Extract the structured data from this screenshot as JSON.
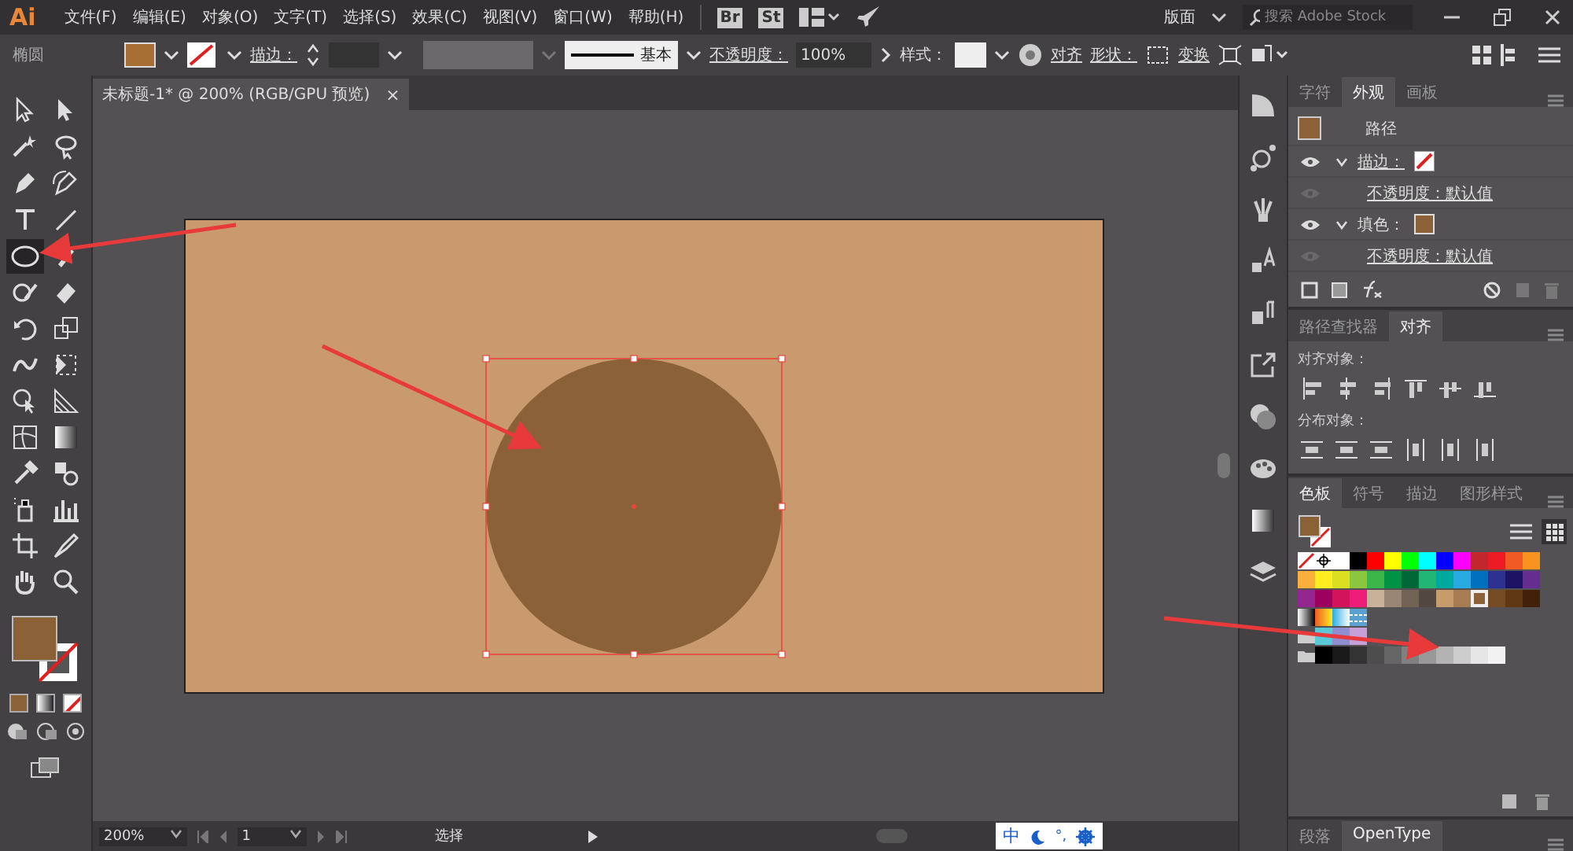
{
  "app": {
    "logo": "Ai",
    "bridge": "Br",
    "stock": "St",
    "workspace": "版面",
    "search_placeholder": "搜索 Adobe Stock"
  },
  "menu": [
    "文件(F)",
    "编辑(E)",
    "对象(O)",
    "文字(T)",
    "选择(S)",
    "效果(C)",
    "视图(V)",
    "窗口(W)",
    "帮助(H)"
  ],
  "control_bar": {
    "selection": "椭圆",
    "stroke_label": "描边：",
    "stroke_profile": "基本",
    "opacity_label": "不透明度：",
    "opacity": "100%",
    "style_label": "样式：",
    "align": "对齐",
    "shape_label": "形状：",
    "transform": "变换"
  },
  "document_tab": {
    "title": "未标题-1* @ 200% (RGB/GPU 预览)",
    "close": "×"
  },
  "tools": [
    {
      "selected": false
    },
    {
      "selected": false
    },
    {
      "selected": false
    },
    {
      "selected": false
    },
    {
      "selected": false
    },
    {
      "selected": false
    },
    {
      "selected": false
    },
    {
      "selected": false
    },
    {
      "selected": true
    },
    {
      "selected": false
    },
    {
      "selected": false
    },
    {
      "selected": false
    },
    {
      "selected": false
    },
    {
      "selected": false
    },
    {
      "selected": false
    },
    {
      "selected": false
    },
    {
      "selected": false
    },
    {
      "selected": false
    },
    {
      "selected": false
    },
    {
      "selected": false
    },
    {
      "selected": false
    },
    {
      "selected": false
    },
    {
      "selected": false
    },
    {
      "selected": false
    },
    {
      "selected": false
    },
    {
      "selected": false
    },
    {
      "selected": false
    },
    {
      "selected": false
    }
  ],
  "appearance_panel": {
    "tabs": [
      {
        "label": "字符",
        "selected": false
      },
      {
        "label": "外观",
        "selected": true
      },
      {
        "label": "画板",
        "selected": false
      }
    ],
    "title": "路径",
    "rows": [
      {
        "kind": "stroke",
        "label": "描边：",
        "expanded": true
      },
      {
        "kind": "sub",
        "label": "不透明度：默认值"
      },
      {
        "kind": "fill",
        "label": "填色：",
        "expanded": true
      },
      {
        "kind": "sub",
        "label": "不透明度：默认值"
      }
    ]
  },
  "align_panel": {
    "tabs": [
      {
        "label": "路径查找器",
        "selected": false
      },
      {
        "label": "对齐",
        "selected": true
      }
    ],
    "align_label": "对齐对象：",
    "distribute_label": "分布对象："
  },
  "swatches_panel": {
    "tabs": [
      {
        "label": "色板",
        "selected": true
      },
      {
        "label": "符号",
        "selected": false
      },
      {
        "label": "描边",
        "selected": false
      },
      {
        "label": "图形样式",
        "selected": false
      }
    ],
    "rows": [
      [
        {
          "kind": "none",
          "selected": false
        },
        {
          "kind": "registration",
          "selected": false
        },
        {
          "color": "#ffffff",
          "selected": false
        },
        {
          "color": "#000000",
          "selected": false
        },
        {
          "color": "#ff0000",
          "selected": false
        },
        {
          "color": "#ffff00",
          "selected": false
        },
        {
          "color": "#00ff00",
          "selected": false
        },
        {
          "color": "#00ffff",
          "selected": false
        },
        {
          "color": "#0000ff",
          "selected": false
        },
        {
          "color": "#ff00ff",
          "selected": false
        },
        {
          "color": "#c1272d",
          "selected": false
        },
        {
          "color": "#ed1c24",
          "selected": false
        },
        {
          "color": "#f15a24",
          "selected": false
        },
        {
          "color": "#f7931e",
          "selected": false
        }
      ],
      [
        {
          "color": "#fbb03b",
          "selected": false
        },
        {
          "color": "#fcee21",
          "selected": false
        },
        {
          "color": "#d9e021",
          "selected": false
        },
        {
          "color": "#8cc63f",
          "selected": false
        },
        {
          "color": "#39b54a",
          "selected": false
        },
        {
          "color": "#009245",
          "selected": false
        },
        {
          "color": "#006837",
          "selected": false
        },
        {
          "color": "#22b573",
          "selected": false
        },
        {
          "color": "#00a99d",
          "selected": false
        },
        {
          "color": "#29abe2",
          "selected": false
        },
        {
          "color": "#0071bc",
          "selected": false
        },
        {
          "color": "#2e3192",
          "selected": false
        },
        {
          "color": "#1b1464",
          "selected": false
        },
        {
          "color": "#662d91",
          "selected": false
        }
      ],
      [
        {
          "color": "#93278f",
          "selected": false
        },
        {
          "color": "#9e005d",
          "selected": false
        },
        {
          "color": "#d4145a",
          "selected": false
        },
        {
          "color": "#ed1e79",
          "selected": false
        },
        {
          "color": "#c7b299",
          "selected": false
        },
        {
          "color": "#998675",
          "selected": false
        },
        {
          "color": "#736357",
          "selected": false
        },
        {
          "color": "#534741",
          "selected": false
        },
        {
          "color": "#c69c6d",
          "selected": false
        },
        {
          "color": "#a67c52",
          "selected": false
        },
        {
          "color": "#8c6239",
          "selected": true
        },
        {
          "color": "#754c24",
          "selected": false
        },
        {
          "color": "#603813",
          "selected": false
        },
        {
          "color": "#42210b",
          "selected": false
        }
      ]
    ],
    "grays": [
      {
        "color": "#000000"
      },
      {
        "color": "#1a1a1a"
      },
      {
        "color": "#333333"
      },
      {
        "color": "#4d4d4d"
      },
      {
        "color": "#666666"
      },
      {
        "color": "#808080"
      },
      {
        "color": "#999999"
      },
      {
        "color": "#b3b3b3"
      },
      {
        "color": "#cccccc"
      },
      {
        "color": "#e6e6e6"
      },
      {
        "color": "#f2f2f2"
      }
    ]
  },
  "bottom_panel": {
    "tabs": [
      {
        "label": "段落",
        "selected": false
      },
      {
        "label": "OpenType",
        "selected": true
      }
    ]
  },
  "status_bar": {
    "zoom": "200%",
    "page": "1",
    "tool": "选择"
  },
  "ime": {
    "language": "中",
    "punctuation": "°,"
  }
}
